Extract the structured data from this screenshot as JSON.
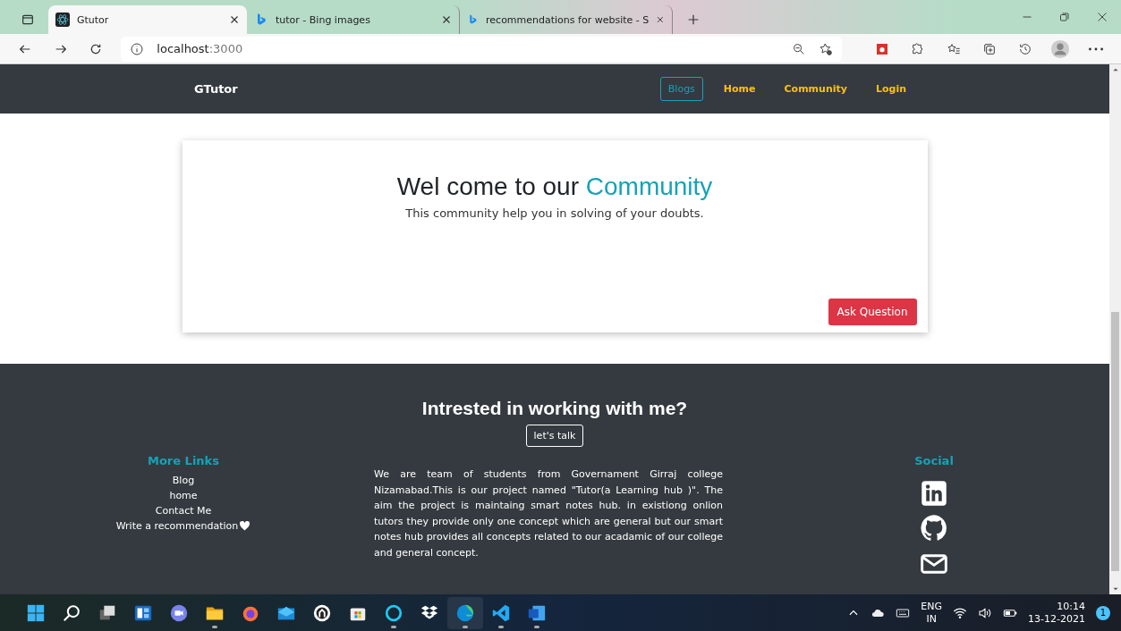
{
  "browser": {
    "tabs": [
      {
        "title": "Gtutor",
        "selected": true
      },
      {
        "title": "tutor - Bing images",
        "selected": false
      },
      {
        "title": "recommendations for website - S",
        "selected": false
      }
    ],
    "address": {
      "host": "localhost",
      "port": ":3000"
    }
  },
  "navbar": {
    "brand": "GTutor",
    "links": [
      {
        "label": "Blogs",
        "selected": true
      },
      {
        "label": "Home",
        "selected": false
      },
      {
        "label": "Community",
        "selected": false
      },
      {
        "label": "Login",
        "selected": false
      }
    ]
  },
  "hero": {
    "title_start": "Wel come to our ",
    "title_accent": "Community",
    "subtitle": "This community help you in solving of your doubts.",
    "button": "Ask Question"
  },
  "footer": {
    "heading": "Intrested in working with me?",
    "cta": "let's talk",
    "links_title": "More Links",
    "links": [
      "Blog",
      "home",
      "Contact Me",
      "Write a recommendation"
    ],
    "about": "We are team of students from Governament Girraj college Nizamabad.This is our project named \"Tutor(a Learning hub )\". The aim the project is maintaing smart notes hub. in existiong onlion tutors they provide only one concept which are general but our smart notes hub provides all concepts related to our acadamic of our college and general concept.",
    "social_title": "Social"
  },
  "taskbar": {
    "apps": [
      {
        "kind": "start",
        "running": false
      },
      {
        "kind": "search",
        "running": false
      },
      {
        "kind": "taskview",
        "running": false
      },
      {
        "kind": "widgets",
        "running": false
      },
      {
        "kind": "chat",
        "running": false
      },
      {
        "kind": "explorer",
        "running": true
      },
      {
        "kind": "firefox",
        "running": false
      },
      {
        "kind": "mail",
        "running": false
      },
      {
        "kind": "github",
        "running": false
      },
      {
        "kind": "store",
        "running": false
      },
      {
        "kind": "alexa",
        "running": true
      },
      {
        "kind": "dropbox",
        "running": false
      },
      {
        "kind": "edge",
        "running": true
      },
      {
        "kind": "vscode",
        "running": true
      },
      {
        "kind": "word",
        "running": true
      }
    ],
    "lang": "ENG",
    "region": "IN",
    "time": "10:14",
    "date": "13-12-2021",
    "notifications": "1"
  }
}
